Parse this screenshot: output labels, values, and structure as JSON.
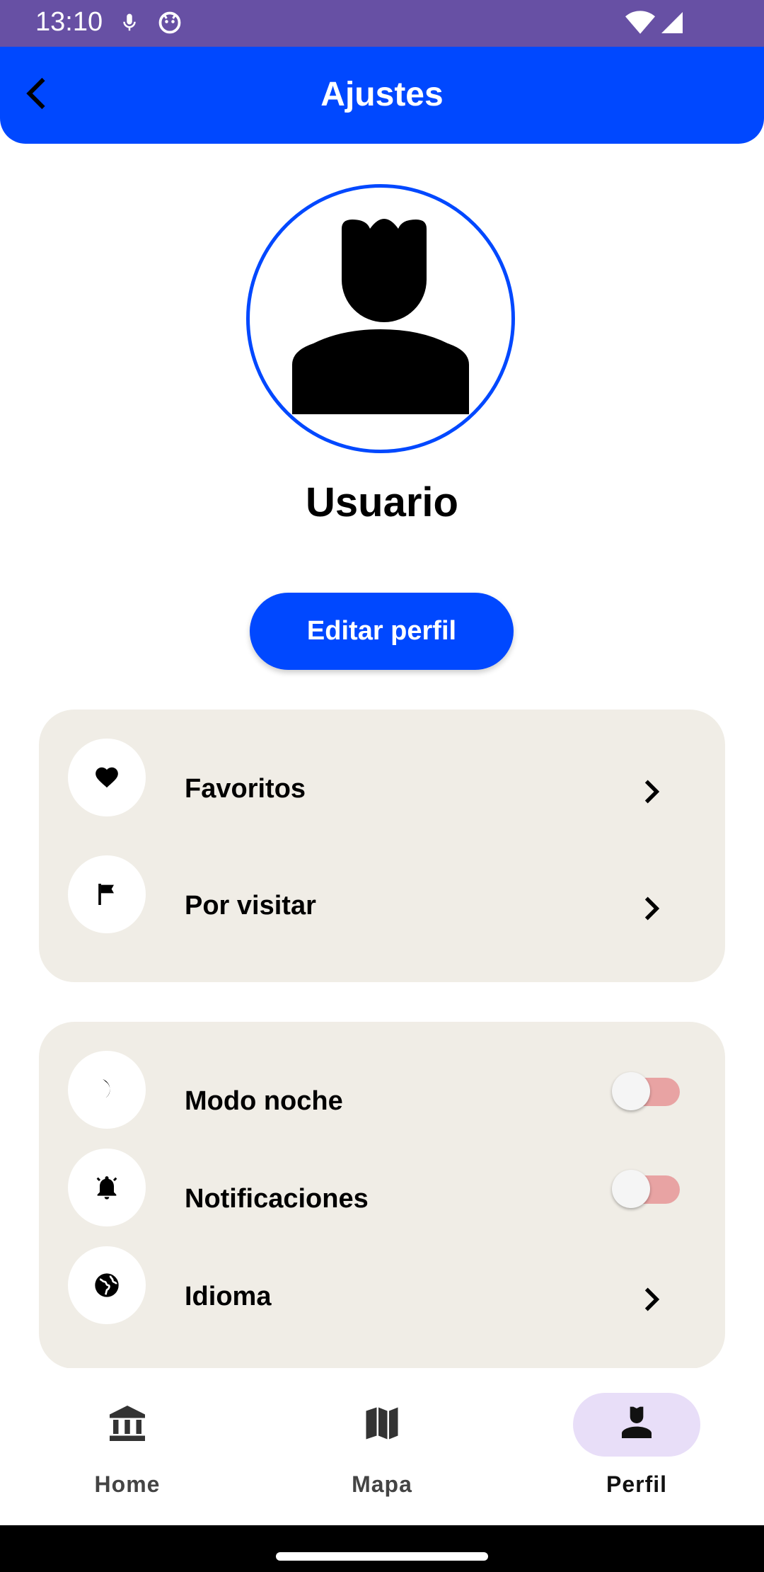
{
  "status_bar": {
    "time": "13:10",
    "left_icons": [
      "mic-icon",
      "face-icon"
    ],
    "right_icons": [
      "wifi-icon",
      "signal-icon"
    ]
  },
  "app_bar": {
    "title": "Ajustes",
    "back_icon": "chevron-left-icon",
    "background": "#0048FF"
  },
  "profile": {
    "avatar_icon": "person-icon",
    "username": "Usuario",
    "edit_button": "Editar perfil"
  },
  "lists_card": {
    "items": [
      {
        "icon": "heart-icon",
        "label": "Favoritos",
        "action": "chevron-right"
      },
      {
        "icon": "flag-icon",
        "label": "Por visitar",
        "action": "chevron-right"
      }
    ]
  },
  "settings_card": {
    "items": [
      {
        "icon": "moon-icon",
        "label": "Modo noche",
        "action": "toggle",
        "on": false
      },
      {
        "icon": "bell-icon",
        "label": "Notificaciones",
        "action": "toggle",
        "on": false
      },
      {
        "icon": "globe-icon",
        "label": "Idioma",
        "action": "chevron-right"
      }
    ]
  },
  "bottom_nav": {
    "items": [
      {
        "icon": "museum-icon",
        "label": "Home",
        "active": false
      },
      {
        "icon": "map-icon",
        "label": "Mapa",
        "active": false
      },
      {
        "icon": "person-icon",
        "label": "Perfil",
        "active": true
      }
    ]
  },
  "colors": {
    "primary": "#0048FF",
    "status_bar": "#6750A4",
    "card": "#F0EDE6",
    "nav_active": "#E8DEF8",
    "toggle_track": "#E8A3A3"
  }
}
